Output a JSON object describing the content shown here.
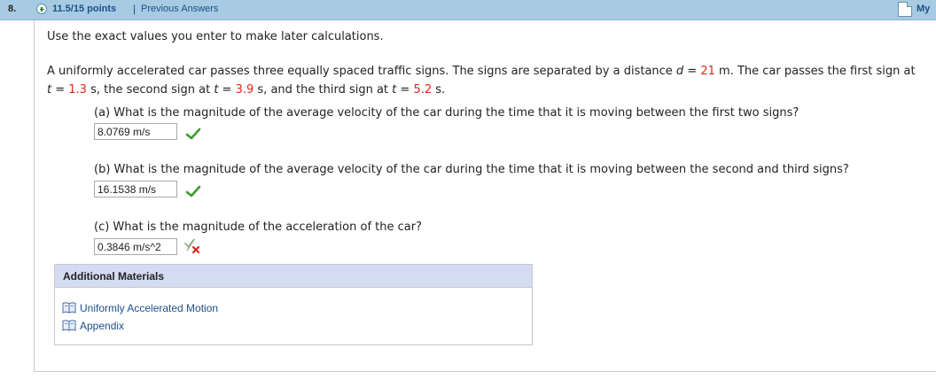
{
  "header": {
    "question_number": "8.",
    "points": "11.5/15 points",
    "separator": "|",
    "previous_answers": "Previous Answers",
    "my_notes": "My",
    "icons": {
      "expand": "plus-circle-icon",
      "notes": "note-page-icon"
    }
  },
  "instructions": "Use the exact values you enter to make later calculations.",
  "problem": {
    "line1_a": "A uniformly accelerated car passes three equally spaced traffic signs. The signs are separated by a distance ",
    "var_d": "d",
    "eq_d": " = ",
    "d_value": "21",
    "line1_b": " m. The car passes the first sign at",
    "var_t1": "t",
    "eq_t1": " = ",
    "t1_value": "1.3",
    "line2_a": " s, the second sign at ",
    "var_t2": "t",
    "eq_t2": " = ",
    "t2_value": "3.9",
    "line2_b": " s, and the third sign at ",
    "var_t3": "t",
    "eq_t3": " = ",
    "t3_value": "5.2",
    "line2_c": " s.",
    "value_color": "#e0261c"
  },
  "parts": [
    {
      "question": "(a) What is the magnitude of the average velocity of the car during the time that it is moving between the first two signs?",
      "answer": "8.0769 m/s",
      "status": "correct"
    },
    {
      "question": "(b) What is the magnitude of the average velocity of the car during the time that it is moving between the second and third signs?",
      "answer": "16.1538 m/s",
      "status": "correct"
    },
    {
      "question": "(c) What is the magnitude of the acceleration of the car?",
      "answer": "0.3846 m/s^2",
      "status": "partially-correct"
    }
  ],
  "additional_materials": {
    "title": "Additional Materials",
    "links": [
      {
        "label": "Uniformly Accelerated Motion",
        "icon": "book-icon"
      },
      {
        "label": "Appendix",
        "icon": "book-icon"
      }
    ]
  },
  "colors": {
    "header_bg": "#a6cbe2",
    "link": "#1e4f88",
    "correct": "#3c9a2e",
    "wrong": "#e0261c",
    "materials_header_bg": "#d4dcf4"
  }
}
